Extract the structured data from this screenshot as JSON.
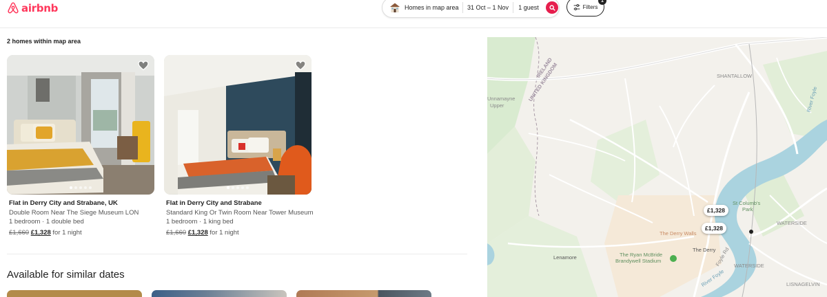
{
  "brand": {
    "name": "airbnb",
    "color": "#ff385c"
  },
  "search": {
    "location": "Homes in map area",
    "dates": "31 Oct – 1 Nov",
    "guests": "1 guest",
    "search_icon": "search-icon"
  },
  "filters": {
    "label": "Filters",
    "count": "1"
  },
  "results": {
    "count_text": "2 homes within map area"
  },
  "listings": [
    {
      "title": "Flat in Derry City and Strabane, UK",
      "name": "Double Room Near The Siege Museum LON",
      "beds": "1 bedroom · 1 double bed",
      "price_old": "£1,660",
      "price_new": "£1,328",
      "price_suffix": "for 1 night"
    },
    {
      "title": "Flat in Derry City and Strabane",
      "name": "Standard King Or Twin Room Near Tower Museum...",
      "beds": "1 bedroom · 1 king bed",
      "price_old": "£1,660",
      "price_new": "£1,328",
      "price_suffix": "for 1 night"
    }
  ],
  "similar": {
    "title": "Available for similar dates"
  },
  "map": {
    "labels": {
      "ireland": "IRELAND",
      "uk": "UNITED KINGDOM",
      "unnamayne": "Unnamayne",
      "upper": "Upper",
      "shantallow": "SHANTALLOW",
      "stcolumbs": "St Columb's",
      "park": "Park",
      "waterside": "WATERSIDE",
      "waterside2": "WATERSIDE",
      "derrywalls": "The Derry Walls",
      "thederry": "The Derry",
      "stadium1": "The Ryan McBride",
      "stadium2": "Brandywell Stadium",
      "lenamore": "Lenamore",
      "lisnagelvin": "LISNAGELVIN",
      "river": "River Foyle",
      "river2": "River Foyle",
      "road": "Foyle Rd"
    },
    "pins": [
      "£1,328",
      "£1,328"
    ]
  }
}
